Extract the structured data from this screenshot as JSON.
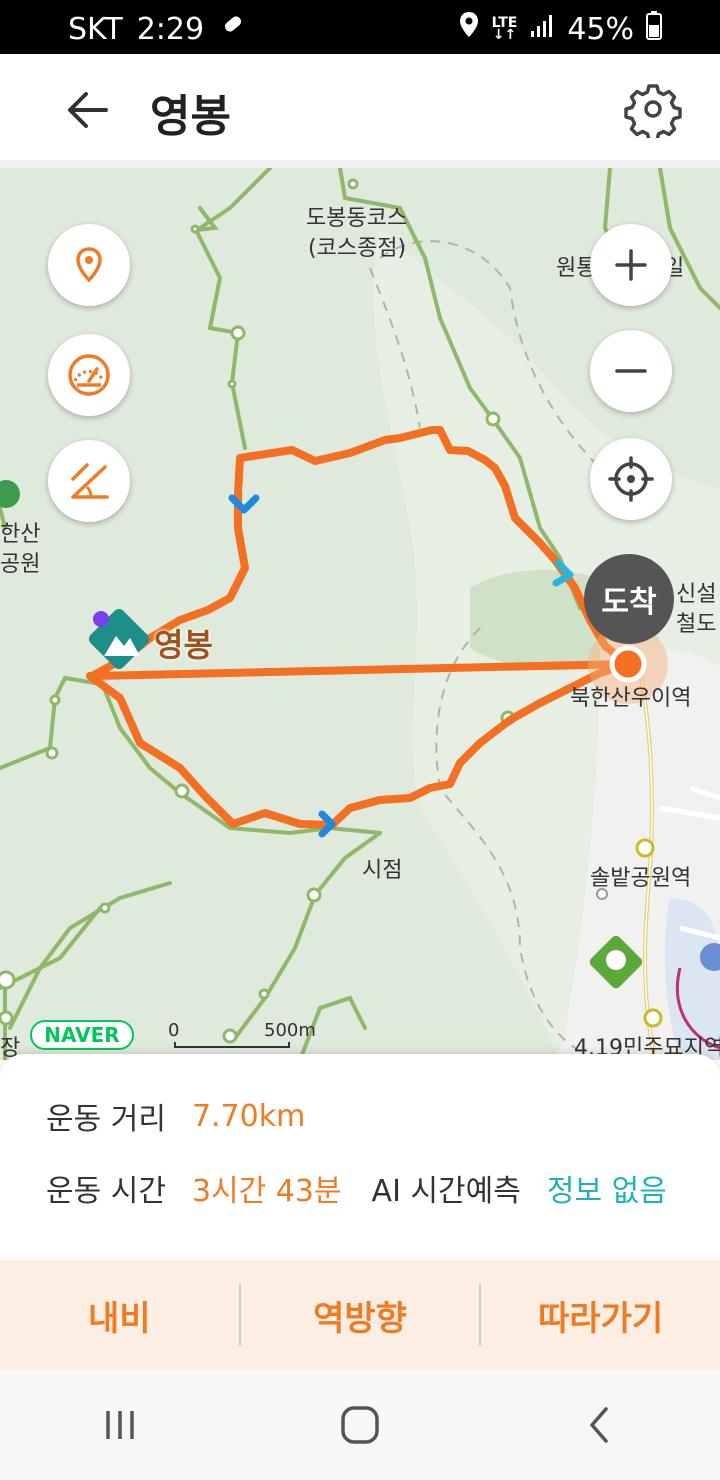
{
  "status_bar": {
    "carrier": "SKT",
    "time": "2:29",
    "network_top": "LTE",
    "battery": "45%"
  },
  "header": {
    "title": "영봉",
    "back_icon": "arrow-left-icon",
    "settings_icon": "gear-icon"
  },
  "map": {
    "labels": {
      "course_name_line1": "도봉동코스",
      "course_name_line2": "(코스종점)",
      "station_wondo": "원통",
      "station_wondo_tail": "일",
      "park_left_1": "한산",
      "park_left_2": "공원",
      "peak": "영봉",
      "rail_line1": "신설",
      "rail_line2": "철도",
      "station_bukhansan": "북한산우이역",
      "start": "시점",
      "station_solbat": "솔밭공원역",
      "memorial": "4.19민주묘지역",
      "bottom_left": "장",
      "arrive": "도착"
    },
    "brand": "NAVER",
    "scale_min": "0",
    "scale_max": "500m",
    "left_buttons": [
      "location-pin-icon",
      "speedometer-icon",
      "slope-icon"
    ],
    "right_buttons": [
      "zoom-in-icon",
      "zoom-out-icon",
      "crosshair-icon"
    ],
    "colors": {
      "route": "#f36f21",
      "trail": "#8fb86a",
      "land": "#dfe9dc",
      "urban": "#f1f1ef"
    }
  },
  "info": {
    "distance_label": "운동 거리",
    "distance_value": "7.70km",
    "time_label": "운동 시간",
    "time_value": "3시간 43분",
    "ai_label": "AI 시간예측",
    "ai_value": "정보 없음"
  },
  "actions": {
    "navi": "내비",
    "reverse": "역방향",
    "follow": "따라가기"
  },
  "nav_bar": [
    "recent-apps-icon",
    "home-icon",
    "back-icon"
  ],
  "accent_color": "#f07b25",
  "teal_color": "#1fb3b9"
}
